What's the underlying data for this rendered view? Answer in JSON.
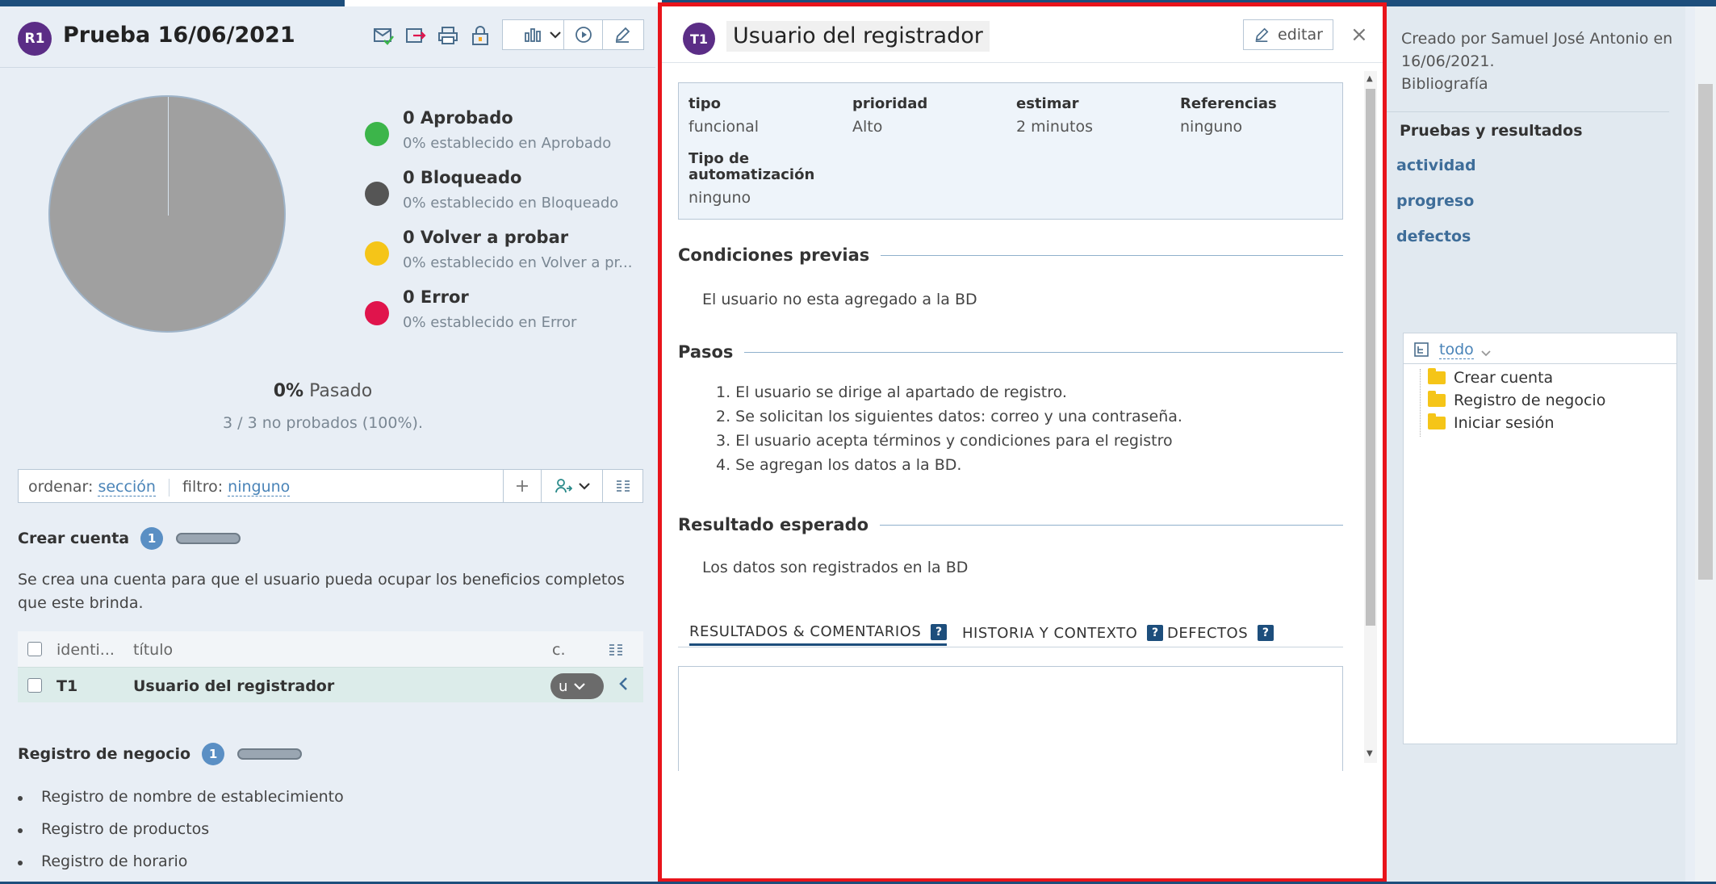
{
  "run": {
    "avatar": "R1",
    "title": "Prueba 16/06/2021",
    "toolbar_icons": [
      "envelope-check-icon",
      "export-icon",
      "print-icon",
      "lock-icon"
    ],
    "chart_button_icon": "bar-chart-icon",
    "play_icon": "play-icon",
    "edit_icon": "pencil-icon"
  },
  "chart_data": {
    "type": "pie",
    "categories": [
      "Aprobado",
      "Bloqueado",
      "Volver a probar",
      "Error",
      "no probados"
    ],
    "values": [
      0,
      0,
      0,
      0,
      3
    ],
    "colors": [
      "#3cb54a",
      "#555555",
      "#f5c518",
      "#e0144c",
      "#a0a0a0"
    ]
  },
  "legend": [
    {
      "label": "0 Aprobado",
      "sub": "0% establecido en Aprobado",
      "color": "#3cb54a"
    },
    {
      "label": "0 Bloqueado",
      "sub": "0% establecido en Bloqueado",
      "color": "#555555"
    },
    {
      "label": "0 Volver a probar",
      "sub": "0% establecido en Volver a pr...",
      "color": "#f5c518"
    },
    {
      "label": "0 Error",
      "sub": "0% establecido en Error",
      "color": "#e0144c"
    }
  ],
  "summary": {
    "percent": "0%",
    "passed_label": " Pasado",
    "untested": "3 / 3 no probados (100%)."
  },
  "filter": {
    "sort_label": "ordenar:",
    "sort_value": "sección",
    "filter_label": "filtro:",
    "filter_value": "ninguno",
    "add_icon": "plus-icon",
    "assign_icon": "user-assign-icon",
    "columns_icon": "columns-icon"
  },
  "section1": {
    "title": "Crear cuenta",
    "count": "1",
    "description": "Se crea una cuenta para que el usuario pueda ocupar los beneficios completos que este brinda.",
    "columns": [
      "identi...",
      "título",
      "c."
    ],
    "rows": [
      {
        "id": "T1",
        "title": "Usuario del registrador",
        "status": "u"
      }
    ]
  },
  "section2": {
    "title": "Registro de negocio",
    "count": "1",
    "items": [
      "Registro de nombre de establecimiento",
      "Registro de productos",
      "Registro de horario"
    ]
  },
  "test": {
    "avatar": "T1",
    "title": "Usuario del registrador",
    "edit_label": "editar",
    "close": "×",
    "fields": {
      "tipo_label": "tipo",
      "tipo_value": "funcional",
      "prioridad_label": "prioridad",
      "prioridad_value": "Alto",
      "estimar_label": "estimar",
      "estimar_value": "2 minutos",
      "referencias_label": "Referencias",
      "referencias_value": "ninguno",
      "automatizacion_label": "Tipo de automatización",
      "automatizacion_value": "ninguno"
    },
    "preconditions_title": "Condiciones previas",
    "preconditions": "El usuario no esta agregado a la BD",
    "steps_title": "Pasos",
    "steps": [
      "1. El usuario se dirige al apartado de registro.",
      "2. Se solicitan los siguientes datos: correo y una contraseña.",
      "3. El usuario acepta términos y condiciones para el registro",
      "4. Se agregan los datos a la BD."
    ],
    "expected_title": "Resultado esperado",
    "expected": "Los datos son registrados en la BD",
    "tabs": [
      "RESULTADOS & COMENTARIOS",
      "HISTORIA Y CONTEXTO",
      "DEFECTOS"
    ],
    "help": "?"
  },
  "sidebar": {
    "created": "Creado por Samuel José Antonio en 16/06/2021.",
    "bibliography": "Bibliografía",
    "heading": "Pruebas y resultados",
    "links": [
      "actividad",
      "progreso",
      "defectos"
    ],
    "tree_filter": "todo",
    "tree_items": [
      "Crear cuenta",
      "Registro de negocio",
      "Iniciar sesión"
    ]
  }
}
